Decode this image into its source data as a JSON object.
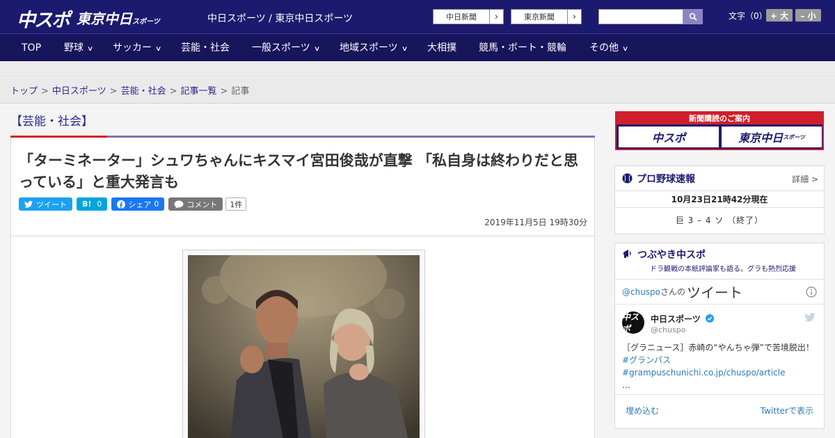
{
  "header": {
    "logo_chuspo": "中スポ",
    "logo_tokyo": "東京中日",
    "logo_tokyo_small": "スポーツ",
    "site_names": "中日スポーツ / 東京中日スポーツ",
    "ext_links": [
      {
        "label": "中日新聞"
      },
      {
        "label": "東京新聞"
      }
    ],
    "search_placeholder": "",
    "font_size_label": "文字（0）",
    "font_plus": "+ 大",
    "font_minus": "– 小"
  },
  "nav": {
    "items": [
      {
        "label": "TOP",
        "has_menu": false
      },
      {
        "label": "野球",
        "has_menu": true
      },
      {
        "label": "サッカー",
        "has_menu": true
      },
      {
        "label": "芸能・社会",
        "has_menu": false
      },
      {
        "label": "一般スポーツ",
        "has_menu": true
      },
      {
        "label": "地域スポーツ",
        "has_menu": true
      },
      {
        "label": "大相撲",
        "has_menu": false
      },
      {
        "label": "競馬・ボート・競輪",
        "has_menu": false
      },
      {
        "label": "その他",
        "has_menu": true
      }
    ]
  },
  "breadcrumb": {
    "links": [
      "トップ",
      "中日スポーツ",
      "芸能・社会",
      "記事一覧"
    ],
    "current": "記事",
    "separator": ">"
  },
  "article": {
    "category": "【芸能・社会】",
    "headline": "「ターミネーター」シュワちゃんにキスマイ宮田俊哉が直撃 「私自身は終わりだと思っている」と重大発言も",
    "share": {
      "tweet": "ツイート",
      "hatena": "B!",
      "hatena_count": "0",
      "facebook": "シェア",
      "facebook_count": "0",
      "comment": "コメント",
      "comment_count": "1件"
    },
    "date": "2019年11月5日 19時30分"
  },
  "sidebar": {
    "subscribe": {
      "caption": "新聞購読のご案内",
      "chuspo": "中スポ",
      "tokyo": "東京中日",
      "tokyo_small": "スポーツ"
    },
    "baseball": {
      "title": "プロ野球速報",
      "detail": "詳細 >",
      "time": "10月23日21時42分現在",
      "score": "巨 3 – 4 ソ （終了）"
    },
    "twitter": {
      "title": "つぶやき中スポ",
      "subtitle": "ドラ観戦の本紙評論家も語る。グラも熱烈応援",
      "handle_link": "@chuspo",
      "san": "さんの",
      "tweets_label": "ツイート",
      "name": "中日スポーツ",
      "handle": "@chuspo",
      "avatar_text": "中スポ",
      "tweet_text": "［グラニュース］赤崎の“やんちゃ弾”で苦境脱出！",
      "tweet_tag": "#グランパス",
      "tweet_url": "#grampuschunichi.co.jp/chuspo/article",
      "tweet_more": "…",
      "embed": "埋め込む",
      "view_on": "Twitterで表示"
    }
  },
  "colors": {
    "brand_navy": "#1c1a6e",
    "accent_red": "#d11e2c",
    "twitter_blue": "#1da1f2",
    "facebook_blue": "#1877f2",
    "hatena_blue": "#00a4de"
  }
}
